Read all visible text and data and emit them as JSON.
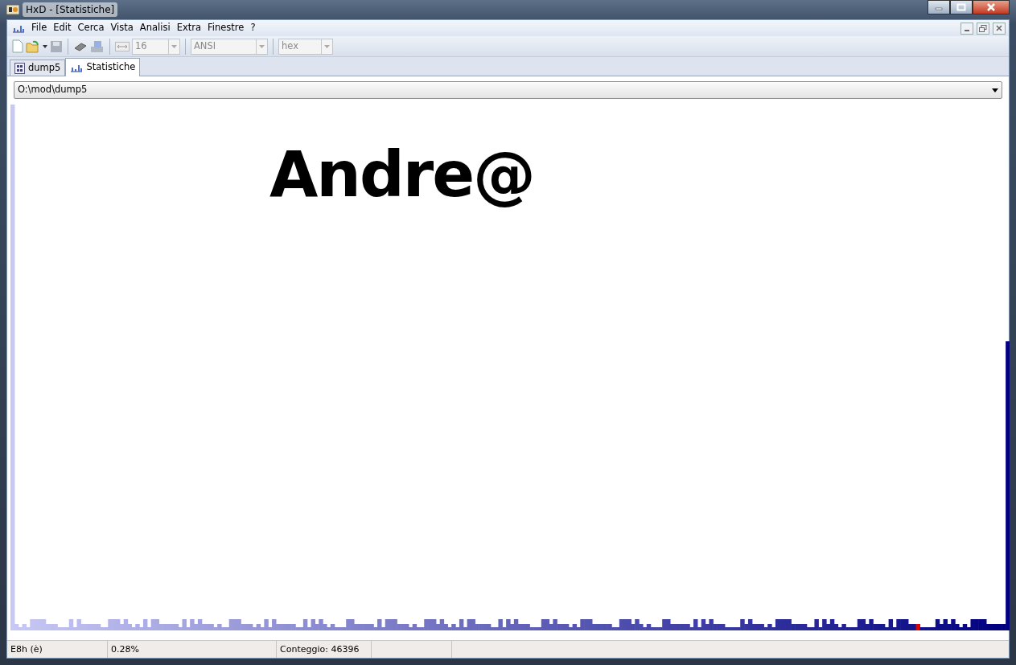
{
  "window": {
    "title": "HxD - [Statistiche]"
  },
  "menu": [
    "File",
    "Edit",
    "Cerca",
    "Vista",
    "Analisi",
    "Extra",
    "Finestre",
    "?"
  ],
  "toolbar": {
    "bytes_per_row": "16",
    "charset": "ANSI",
    "offset_base": "hex"
  },
  "tabs": [
    {
      "label": "dump5",
      "selected": false,
      "kind": "file"
    },
    {
      "label": "Statistiche",
      "selected": true,
      "kind": "stats"
    }
  ],
  "file_select": {
    "value": "O:\\mod\\dump5"
  },
  "overlay_text": "Andre@",
  "status_bar": [
    "E8h (è)",
    "0.28%",
    "Conteggio: 46396"
  ]
}
